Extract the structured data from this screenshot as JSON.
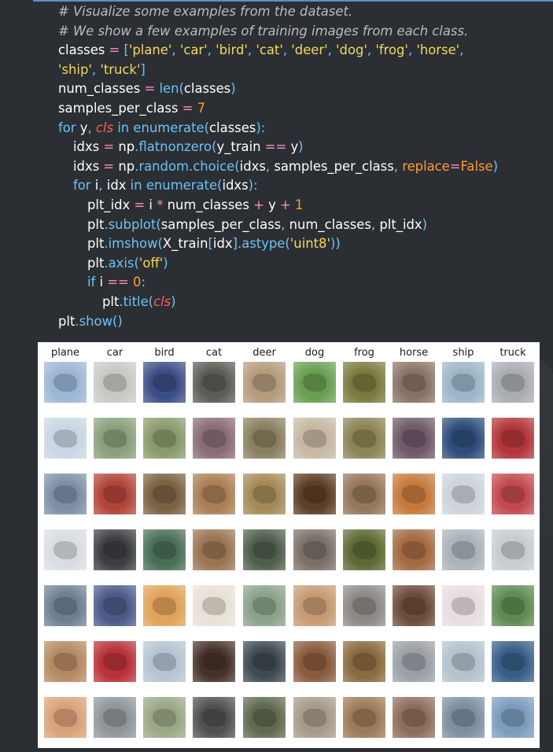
{
  "code": {
    "lines": [
      "# Visualize some examples from the dataset.",
      "# We show a few examples of training images from each class.",
      "classes = ['plane', 'car', 'bird', 'cat', 'deer', 'dog', 'frog', 'horse',",
      "'ship', 'truck']",
      "num_classes = len(classes)",
      "samples_per_class = 7",
      "for y, cls in enumerate(classes):",
      "idxs = np.flatnonzero(y_train == y)",
      "idxs = np.random.choice(idxs, samples_per_class, replace=False)",
      "for i, idx in enumerate(idxs):",
      "plt_idx = i * num_classes + y + 1",
      "plt.subplot(samples_per_class, num_classes, plt_idx)",
      "plt.imshow(X_train[idx].astype('uint8'))",
      "plt.axis('off')",
      "if i == 0:",
      "plt.title(cls)",
      "plt.show()"
    ]
  },
  "figure": {
    "titles": [
      "plane",
      "car",
      "bird",
      "cat",
      "deer",
      "dog",
      "frog",
      "horse",
      "ship",
      "truck"
    ],
    "rows": 7,
    "palette": {
      "plane": [
        "#9bb6d6",
        "#c9d6e3",
        "#7d8fa6",
        "#d9dde2",
        "#6f7f93",
        "#b58a62",
        "#d9a27a"
      ],
      "car": [
        "#c9c9c4",
        "#8aa07a",
        "#b2453b",
        "#3d3e42",
        "#4d5a88",
        "#b8323a",
        "#8f969a"
      ],
      "bird": [
        "#3c4e86",
        "#8a9b6c",
        "#7a6244",
        "#496e56",
        "#e1a25a",
        "#b6c4d2",
        "#9aa886"
      ],
      "cat": [
        "#5d5b55",
        "#8a6c78",
        "#aa7f55",
        "#9a7552",
        "#e8e1d6",
        "#46322a",
        "#505053"
      ],
      "deer": [
        "#b49b7c",
        "#8a8060",
        "#a58a58",
        "#4f5f4c",
        "#8aa28b",
        "#3f4a52",
        "#5f6a4f"
      ],
      "dog": [
        "#6a9e52",
        "#c6b8a4",
        "#5c3f25",
        "#7b7068",
        "#c79a74",
        "#8a5b3e",
        "#a69b8b"
      ],
      "frog": [
        "#7b7a3e",
        "#8b8455",
        "#94765a",
        "#5d6a34",
        "#8d8a86",
        "#8a6a3f",
        "#9c7a58"
      ],
      "horse": [
        "#8a7366",
        "#6e5a68",
        "#c57a3d",
        "#a46a42",
        "#6b4d3a",
        "#9aa1a6",
        "#8d6e5c"
      ],
      "ship": [
        "#9cb6c8",
        "#2f4d7a",
        "#cdd3d8",
        "#aab3b9",
        "#e7dde0",
        "#b4c2cc",
        "#7d8ea0"
      ],
      "truck": [
        "#a9adb2",
        "#b3363a",
        "#c24a4f",
        "#c8ccd0",
        "#5f8a52",
        "#385e88",
        "#7c9cbd"
      ]
    }
  }
}
